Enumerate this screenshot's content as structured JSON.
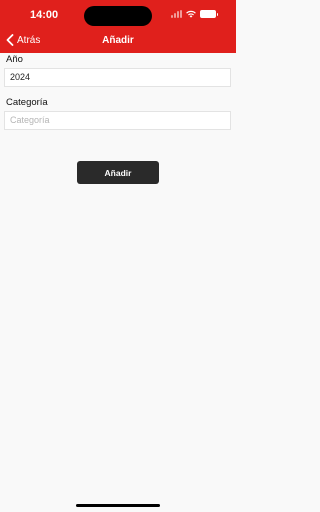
{
  "status": {
    "time": "14:00"
  },
  "nav": {
    "back_label": "Atrás",
    "title": "Añadir"
  },
  "form": {
    "year_label": "Año",
    "year_value": "2024",
    "category_label": "Categoría",
    "category_placeholder": "Categoría"
  },
  "actions": {
    "add_label": "Añadir"
  },
  "colors": {
    "header": "#e0201c",
    "button": "#2a2a2a",
    "background": "#f9f9f9"
  }
}
